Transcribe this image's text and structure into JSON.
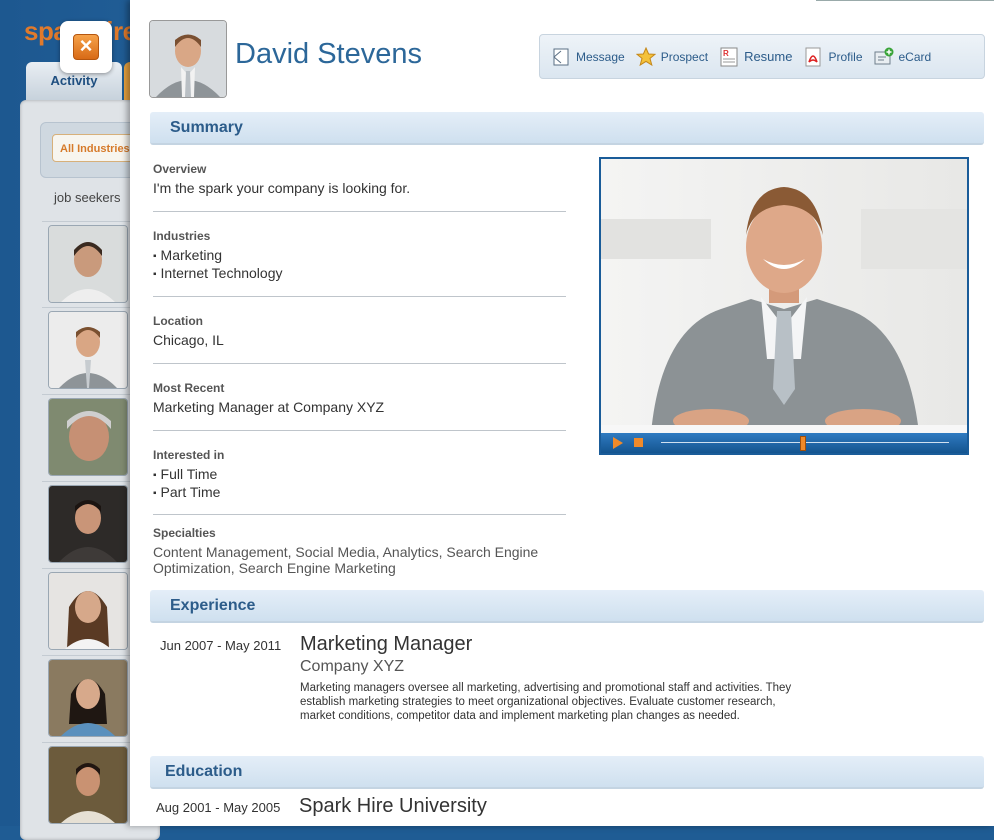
{
  "background": {
    "logo": "sparkhire",
    "tab_activity": "Activity",
    "filter_value": "All Industries",
    "list_label": "job seekers"
  },
  "modal": {
    "close_icon": "close-icon",
    "name": "David Stevens",
    "actions": [
      {
        "label": "Message",
        "icon": "message-icon"
      },
      {
        "label": "Prospect",
        "icon": "star-icon"
      },
      {
        "label": "Resume",
        "icon": "resume-icon"
      },
      {
        "label": "Profile",
        "icon": "pdf-icon"
      },
      {
        "label": "eCard",
        "icon": "ecard-icon"
      }
    ],
    "summary": {
      "heading": "Summary",
      "overview_label": "Overview",
      "overview_value": "I'm the spark your company is looking for.",
      "industries_label": "Industries",
      "industries": [
        "Marketing",
        "Internet Technology"
      ],
      "location_label": "Location",
      "location_value": "Chicago, IL",
      "recent_label": "Most Recent",
      "recent_value": "Marketing Manager at Company XYZ",
      "interested_label": "Interested in",
      "interested": [
        "Full Time",
        "Part Time"
      ],
      "specialties_label": "Specialties",
      "specialties_value": "Content Management, Social Media, Analytics, Search Engine Optimization, Search Engine Marketing"
    },
    "video": {
      "progress": 0.49
    },
    "experience": {
      "heading": "Experience",
      "date": "Jun 2007 - May 2011",
      "title": "Marketing Manager",
      "company": "Company XYZ",
      "description": "Marketing managers oversee all marketing, advertising and promotional staff and activities. They establish marketing strategies to meet organizational objectives. Evaluate customer research, market conditions, competitor data and implement marketing plan changes as needed."
    },
    "education": {
      "heading": "Education",
      "date": "Aug 2001 - May 2005",
      "school": "Spark Hire University"
    }
  }
}
